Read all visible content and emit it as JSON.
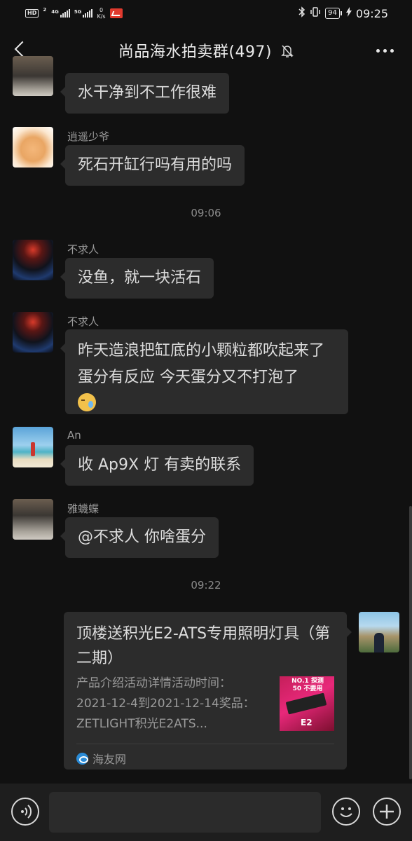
{
  "status_bar": {
    "hd_label": "HD",
    "sim1_label": "2",
    "sim1_tech": "4G",
    "sim2_tech": "5G",
    "net_speed_value": "0",
    "net_speed_unit": "K/s",
    "battery_percent": "94",
    "time": "09:25"
  },
  "header": {
    "title": "尚品海水拍卖群(497)"
  },
  "messages": [
    {
      "text": "水干净到不工作很难"
    },
    {
      "sender": "逍遥少爷",
      "text": "死石开缸行吗有用的吗"
    },
    {
      "sender": "不求人",
      "text": "没鱼，就一块活石"
    },
    {
      "sender": "不求人",
      "text": "昨天造浪把缸底的小颗粒都吹起来了蛋分有反应 今天蛋分又不打泡了"
    },
    {
      "sender": "An",
      "text": "收 Ap9X 灯 有卖的联系"
    },
    {
      "sender": "雅蟣蝶",
      "text": "@不求人  你啥蛋分"
    }
  ],
  "timestamps": [
    "09:06",
    "09:22"
  ],
  "link_card": {
    "title": "顶楼送积光E2-ATS专用照明灯具（第二期）",
    "description": "产品介绍活动详情活动时间：2021-12-4到2021-12-14奖品：ZETLIGHT积光E2ATS...",
    "thumb_top_text": "NO.1 探测\n50 不要用",
    "thumb_bottom_text": "E2",
    "source": "海友网"
  },
  "colors": {
    "background": "#111111",
    "bubble": "#2c2c2c",
    "text": "#dcdcdc",
    "muted": "#9a9a9a"
  },
  "icons": {
    "back": "chevron-left-icon",
    "mute": "bell-slash-icon",
    "more": "ellipsis-icon",
    "voice": "voice-icon",
    "emoji": "smile-icon",
    "add": "plus-icon"
  }
}
